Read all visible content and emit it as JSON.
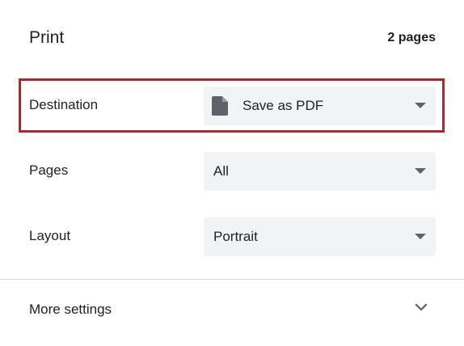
{
  "header": {
    "title": "Print",
    "page_count": "2 pages"
  },
  "settings": {
    "destination": {
      "label": "Destination",
      "value": "Save as PDF",
      "icon": "document-icon"
    },
    "pages": {
      "label": "Pages",
      "value": "All"
    },
    "layout": {
      "label": "Layout",
      "value": "Portrait"
    }
  },
  "more_settings": {
    "label": "More settings",
    "icon": "chevron-down-icon"
  },
  "colors": {
    "highlight_border": "#e0101e",
    "select_background": "#f1f3f4",
    "text": "#202124",
    "icon": "#5f6368"
  }
}
